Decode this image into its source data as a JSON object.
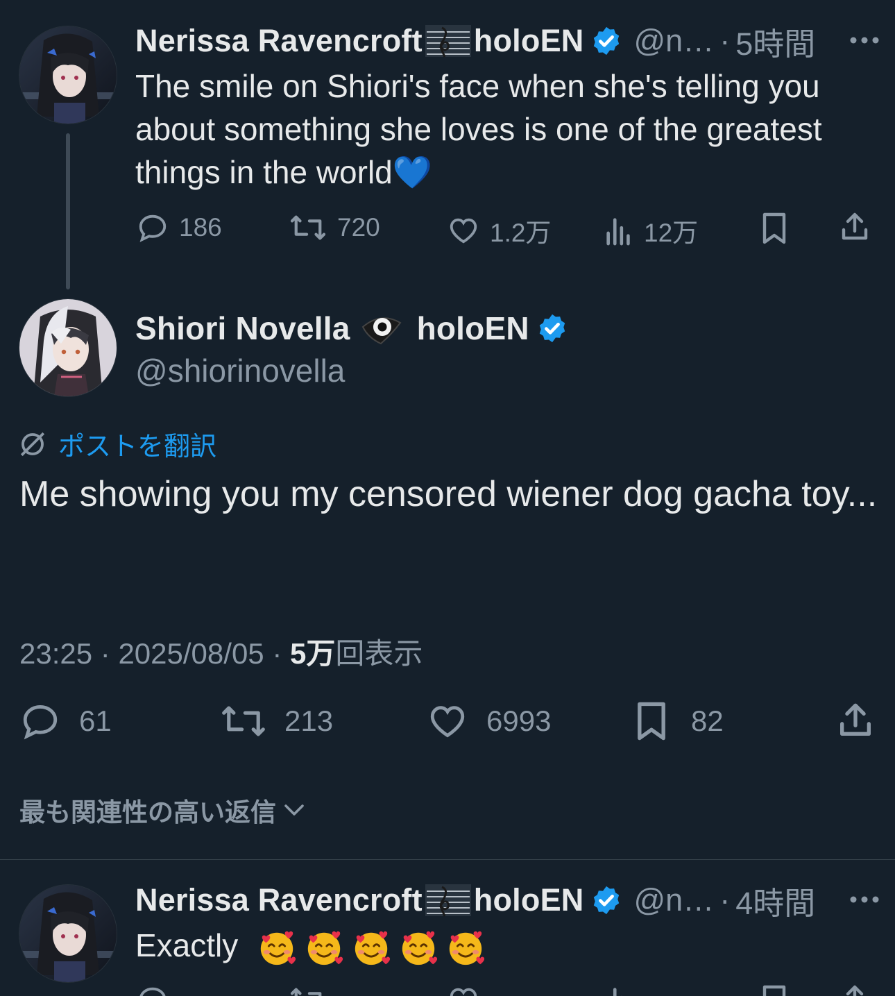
{
  "colors": {
    "background": "#15202b",
    "accent": "#1d9bf0",
    "secondary_text": "#8b98a5",
    "primary_text": "#e7e9ea"
  },
  "parent_tweet": {
    "author_name": "Nerissa Ravencroft",
    "author_suffix": "holoEN",
    "handle": "@n…",
    "dot": "·",
    "time": "5時間",
    "text": "The smile on Shiori's face when she's telling you about something she loves is one of the greatest things in the world💙",
    "replies": "186",
    "reposts": "720",
    "likes": "1.2万",
    "views": "12万"
  },
  "main_tweet": {
    "author_name": "Shiori Novella",
    "author_suffix": "holoEN",
    "handle": "@shiorinovella",
    "translate_label": "ポストを翻訳",
    "text": "Me showing you my censored wiener dog gacha toy...",
    "time": "23:25",
    "date": "2025/08/05",
    "sep": "·",
    "views_count": "5万",
    "views_label": "回表示",
    "replies": "61",
    "reposts": "213",
    "likes": "6993",
    "bookmarks": "82"
  },
  "sort_label": "最も関連性の高い返信",
  "reply_tweet": {
    "author_name": "Nerissa Ravencroft",
    "author_suffix": "holoEN",
    "handle": "@n…",
    "dot": "·",
    "time": "4時間",
    "text": "Exactly"
  },
  "icons": [
    "reply-icon",
    "repost-icon",
    "like-icon",
    "views-icon",
    "bookmark-icon",
    "share-icon",
    "verified-icon",
    "more-icon",
    "translate-icon",
    "chevron-down-icon"
  ]
}
